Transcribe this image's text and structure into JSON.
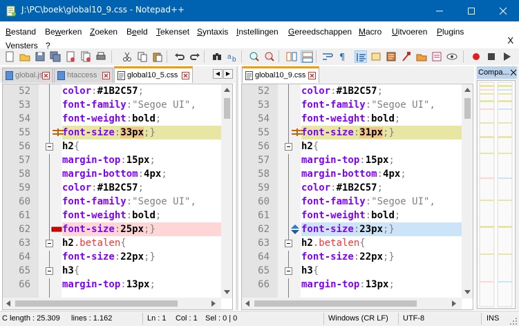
{
  "window": {
    "title": "J:\\PC\\boek\\global10_9.css - Notepad++"
  },
  "menu": {
    "items": [
      {
        "pre": "",
        "u": "B",
        "post": "estand"
      },
      {
        "pre": "Be",
        "u": "w",
        "post": "erken"
      },
      {
        "pre": "",
        "u": "Z",
        "post": "oeken"
      },
      {
        "pre": "B",
        "u": "e",
        "post": "eld"
      },
      {
        "pre": "",
        "u": "T",
        "post": "ekenset"
      },
      {
        "pre": "",
        "u": "S",
        "post": "yntaxis"
      },
      {
        "pre": "",
        "u": "I",
        "post": "nstellingen"
      },
      {
        "pre": "",
        "u": "G",
        "post": "ereedschappen"
      },
      {
        "pre": "",
        "u": "M",
        "post": "acro"
      },
      {
        "pre": "",
        "u": "U",
        "post": "itvoeren"
      },
      {
        "pre": "",
        "u": "P",
        "post": "lugins"
      },
      {
        "pre": "",
        "u": "V",
        "post": "ensters"
      },
      {
        "pre": "",
        "u": "?",
        "post": ""
      }
    ],
    "close": "X"
  },
  "tabs_left": [
    "global.js",
    "htaccess",
    "global10_5.css"
  ],
  "tabs_right": [
    "global10_9.css"
  ],
  "compare_panel": {
    "title": "Compa..."
  },
  "colors": {
    "title_bg": "#0063b1",
    "changed": "#e7e6a3",
    "deleted": "#ffd6d6",
    "moved": "#cce4f7",
    "word_diff": "#f0c58a",
    "property": "#8000ff",
    "selector_class": "#ff3232"
  },
  "editor_left": [
    {
      "n": "52",
      "t": [
        [
          "p",
          "color"
        ],
        [
          "s",
          ":"
        ],
        [
          "b",
          "#1B2C57"
        ],
        [
          "s",
          ";"
        ]
      ]
    },
    {
      "n": "53",
      "t": [
        [
          "p",
          "font-family"
        ],
        [
          "s",
          ":"
        ],
        [
          "s",
          "\"Segoe UI\","
        ]
      ]
    },
    {
      "n": "54",
      "t": [
        [
          "p",
          "font-weight"
        ],
        [
          "s",
          ":"
        ],
        [
          "b",
          "bold"
        ],
        [
          "s",
          ";"
        ]
      ]
    },
    {
      "n": "55",
      "t": [
        [
          "p",
          "font-size"
        ],
        [
          "s",
          ":"
        ],
        [
          "w",
          "33px"
        ],
        [
          "s",
          ";}"
        ]
      ]
    },
    {
      "n": "56",
      "t": [
        [
          "b",
          "h2"
        ],
        [
          "s",
          "{"
        ]
      ]
    },
    {
      "n": "57",
      "t": [
        [
          "p",
          "margin-top"
        ],
        [
          "s",
          ":"
        ],
        [
          "b",
          "15px"
        ],
        [
          "s",
          ";"
        ]
      ]
    },
    {
      "n": "58",
      "t": [
        [
          "p",
          "margin-bottom"
        ],
        [
          "s",
          ":"
        ],
        [
          "b",
          "4px"
        ],
        [
          "s",
          ";"
        ]
      ]
    },
    {
      "n": "59",
      "t": [
        [
          "p",
          "color"
        ],
        [
          "s",
          ":"
        ],
        [
          "b",
          "#1B2C57"
        ],
        [
          "s",
          ";"
        ]
      ]
    },
    {
      "n": "60",
      "t": [
        [
          "p",
          "font-family"
        ],
        [
          "s",
          ":"
        ],
        [
          "s",
          "\"Segoe UI\","
        ]
      ]
    },
    {
      "n": "61",
      "t": [
        [
          "p",
          "font-weight"
        ],
        [
          "s",
          ":"
        ],
        [
          "b",
          "bold"
        ],
        [
          "s",
          ";"
        ]
      ]
    },
    {
      "n": "62",
      "t": [
        [
          "p",
          "font-size"
        ],
        [
          "s",
          ":"
        ],
        [
          "b",
          "25px"
        ],
        [
          "s",
          ";}"
        ]
      ]
    },
    {
      "n": "63",
      "t": [
        [
          "b",
          "h2"
        ],
        [
          "d",
          ".betalen"
        ],
        [
          "s",
          "{"
        ]
      ]
    },
    {
      "n": "64",
      "t": [
        [
          "p",
          "font-size"
        ],
        [
          "s",
          ":"
        ],
        [
          "b",
          "22px"
        ],
        [
          "s",
          ";}"
        ]
      ]
    },
    {
      "n": "65",
      "t": [
        [
          "b",
          "h3"
        ],
        [
          "s",
          "{"
        ]
      ]
    },
    {
      "n": "66",
      "t": [
        [
          "p",
          "margin-top"
        ],
        [
          "s",
          ":"
        ],
        [
          "b",
          "13px"
        ],
        [
          "s",
          ";"
        ]
      ]
    }
  ],
  "editor_right": [
    {
      "n": "52",
      "t": [
        [
          "p",
          "color"
        ],
        [
          "s",
          ":"
        ],
        [
          "b",
          "#1B2C57"
        ],
        [
          "s",
          ";"
        ]
      ]
    },
    {
      "n": "53",
      "t": [
        [
          "p",
          "font-family"
        ],
        [
          "s",
          ":"
        ],
        [
          "s",
          "\"Segoe UI\","
        ]
      ]
    },
    {
      "n": "54",
      "t": [
        [
          "p",
          "font-weight"
        ],
        [
          "s",
          ":"
        ],
        [
          "b",
          "bold"
        ],
        [
          "s",
          ";"
        ]
      ]
    },
    {
      "n": "55",
      "t": [
        [
          "p",
          "font-size"
        ],
        [
          "s",
          ":"
        ],
        [
          "w",
          "31px"
        ],
        [
          "s",
          ";}"
        ]
      ]
    },
    {
      "n": "56",
      "t": [
        [
          "b",
          "h2"
        ],
        [
          "s",
          "{"
        ]
      ]
    },
    {
      "n": "57",
      "t": [
        [
          "p",
          "margin-top"
        ],
        [
          "s",
          ":"
        ],
        [
          "b",
          "15px"
        ],
        [
          "s",
          ";"
        ]
      ]
    },
    {
      "n": "58",
      "t": [
        [
          "p",
          "margin-bottom"
        ],
        [
          "s",
          ":"
        ],
        [
          "b",
          "4px"
        ],
        [
          "s",
          ";"
        ]
      ]
    },
    {
      "n": "59",
      "t": [
        [
          "p",
          "color"
        ],
        [
          "s",
          ":"
        ],
        [
          "b",
          "#1B2C57"
        ],
        [
          "s",
          ";"
        ]
      ]
    },
    {
      "n": "60",
      "t": [
        [
          "p",
          "font-family"
        ],
        [
          "s",
          ":"
        ],
        [
          "s",
          "\"Segoe UI\","
        ]
      ]
    },
    {
      "n": "61",
      "t": [
        [
          "p",
          "font-weight"
        ],
        [
          "s",
          ":"
        ],
        [
          "b",
          "bold"
        ],
        [
          "s",
          ";"
        ]
      ]
    },
    {
      "n": "62",
      "t": [
        [
          "p",
          "font-size"
        ],
        [
          "s",
          ":"
        ],
        [
          "b",
          "23px"
        ],
        [
          "s",
          ";}"
        ]
      ]
    },
    {
      "n": "63",
      "t": [
        [
          "b",
          "h2"
        ],
        [
          "d",
          ".betalen"
        ],
        [
          "s",
          "{"
        ]
      ]
    },
    {
      "n": "64",
      "t": [
        [
          "p",
          "font-size"
        ],
        [
          "s",
          ":"
        ],
        [
          "b",
          "22px"
        ],
        [
          "s",
          ";}"
        ]
      ]
    },
    {
      "n": "65",
      "t": [
        [
          "b",
          "h3"
        ],
        [
          "s",
          "{"
        ]
      ]
    },
    {
      "n": "66",
      "t": [
        [
          "p",
          "margin-top"
        ],
        [
          "s",
          ":"
        ],
        [
          "b",
          "13px"
        ],
        [
          "s",
          ";"
        ]
      ]
    }
  ],
  "status": {
    "length": "C length : 25.309",
    "lines": "lines : 1.162",
    "ln": "Ln : 1",
    "col": "Col : 1",
    "sel": "Sel : 0 | 0",
    "eol": "Windows (CR LF)",
    "enc": "UTF-8",
    "mode": "INS"
  }
}
